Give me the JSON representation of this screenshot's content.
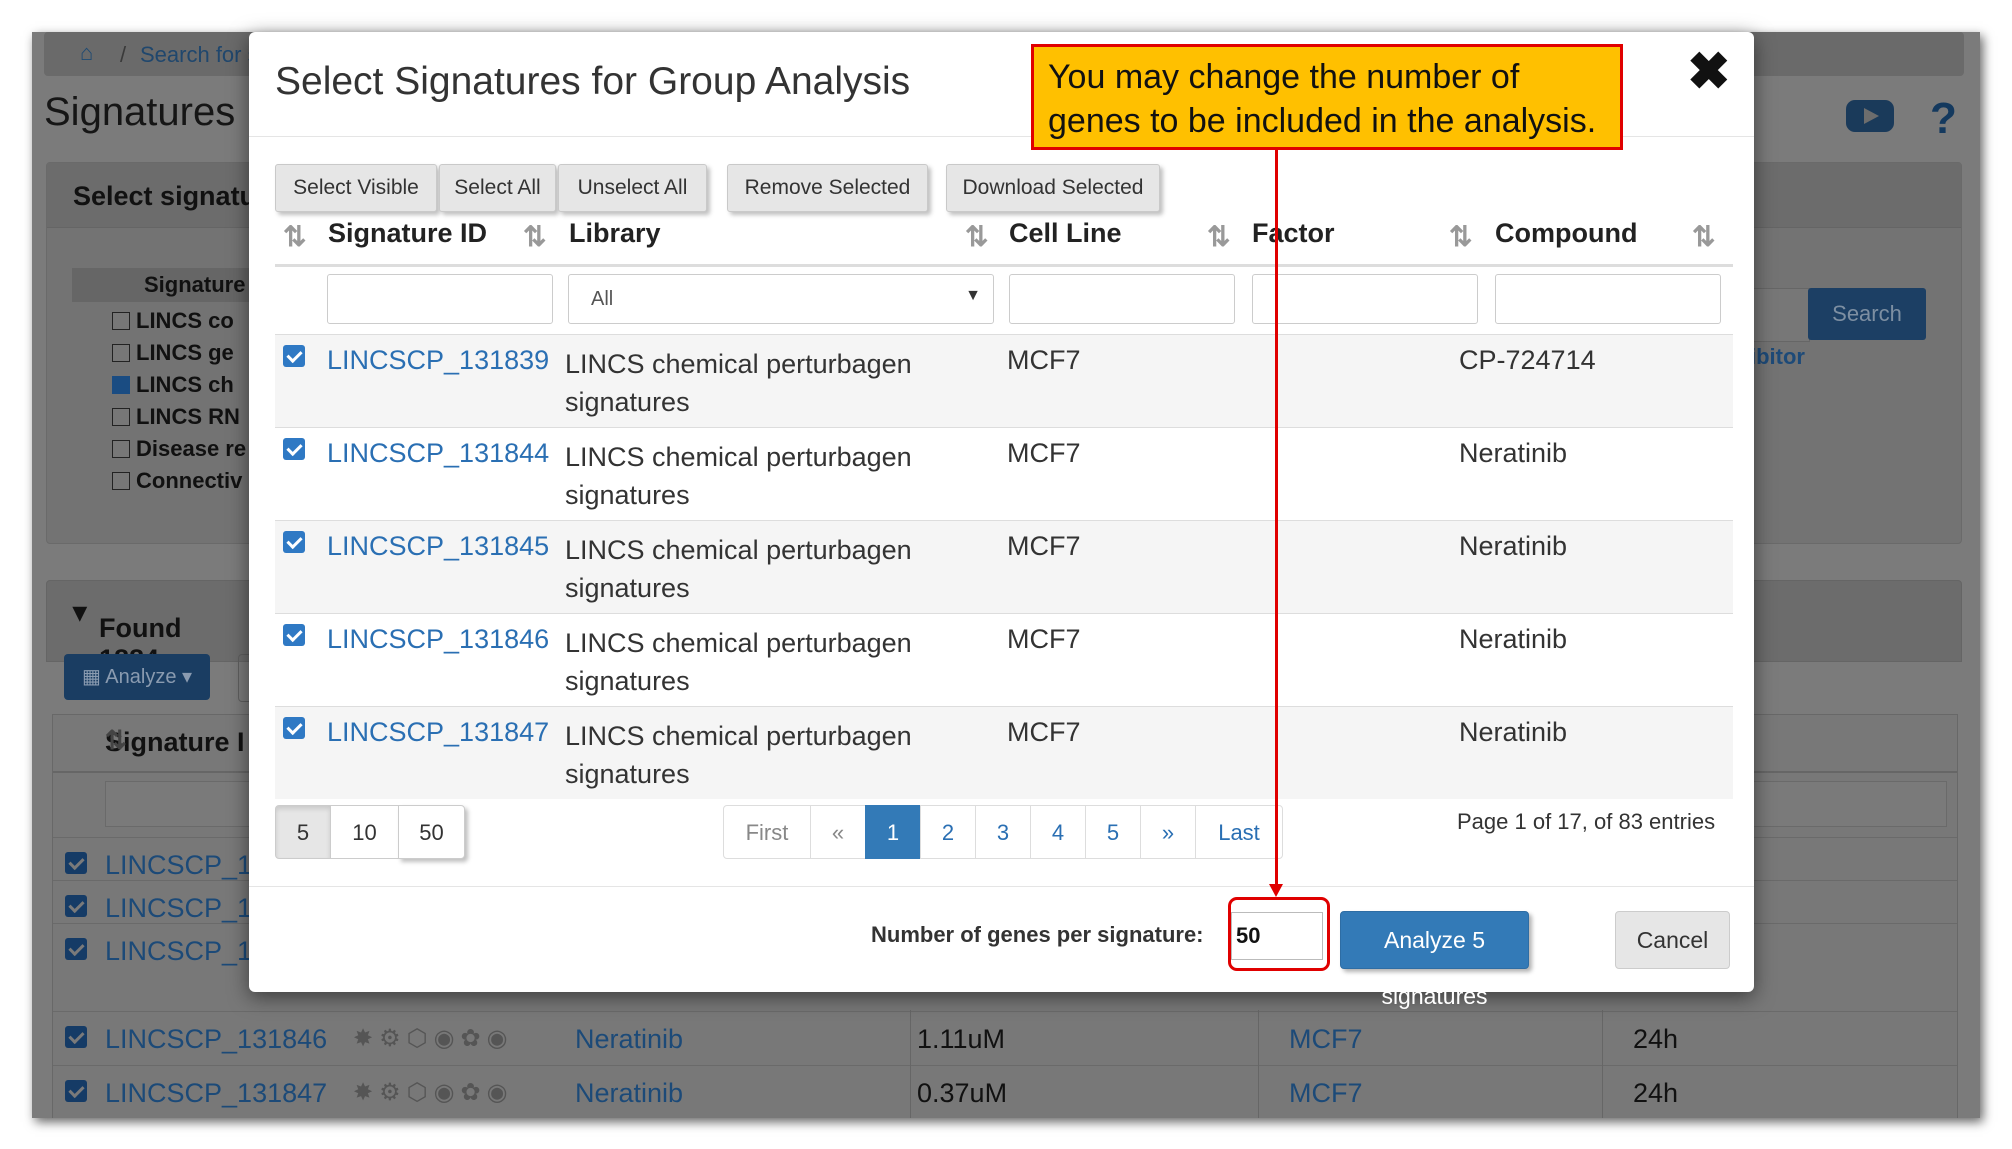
{
  "background": {
    "breadcrumb": "Search for s",
    "title": "Signatures",
    "select_panel_title": "Select signatu",
    "signature_col": "Signature",
    "libraries": [
      {
        "label": "LINCS co",
        "checked": false
      },
      {
        "label": "LINCS ge",
        "checked": false
      },
      {
        "label": "LINCS ch",
        "checked": true
      },
      {
        "label": "LINCS RN",
        "checked": false
      },
      {
        "label": "Disease re",
        "checked": false
      },
      {
        "label": "Connectiv",
        "checked": false
      }
    ],
    "search_button": "Search",
    "partial_link": "ibitor",
    "found_title": "Found 1884",
    "analyze_button": "Analyze",
    "table_header": "Signature I",
    "rows": [
      {
        "id": "LINCSCP_1",
        "compound": "",
        "conc": "",
        "cell": "",
        "time": ""
      },
      {
        "id": "LINCSCP_1",
        "compound": "",
        "conc": "",
        "cell": "",
        "time": ""
      },
      {
        "id": "LINCSCP_1",
        "compound": "",
        "conc": "",
        "cell": "",
        "time": ""
      },
      {
        "id": "LINCSCP_131846",
        "compound": "Neratinib",
        "conc": "1.11uM",
        "cell": "MCF7",
        "time": "24h"
      },
      {
        "id": "LINCSCP_131847",
        "compound": "Neratinib",
        "conc": "0.37uM",
        "cell": "MCF7",
        "time": "24h"
      }
    ]
  },
  "modal": {
    "title": "Select Signatures for Group Analysis",
    "close_icon": "close-icon",
    "toolbar": {
      "select_visible": "Select Visible",
      "select_all": "Select All",
      "unselect_all": "Unselect All",
      "remove_selected": "Remove Selected",
      "download_selected": "Download Selected"
    },
    "columns": {
      "signature_id": "Signature ID",
      "library": "Library",
      "cell_line": "Cell Line",
      "factor": "Factor",
      "compound": "Compound"
    },
    "library_filter_value": "All",
    "rows": [
      {
        "id": "LINCSCP_131839",
        "library": "LINCS chemical perturbagen signatures",
        "cell_line": "MCF7",
        "factor": "",
        "compound": "CP-724714",
        "checked": true
      },
      {
        "id": "LINCSCP_131844",
        "library": "LINCS chemical perturbagen signatures",
        "cell_line": "MCF7",
        "factor": "",
        "compound": "Neratinib",
        "checked": true
      },
      {
        "id": "LINCSCP_131845",
        "library": "LINCS chemical perturbagen signatures",
        "cell_line": "MCF7",
        "factor": "",
        "compound": "Neratinib",
        "checked": true
      },
      {
        "id": "LINCSCP_131846",
        "library": "LINCS chemical perturbagen signatures",
        "cell_line": "MCF7",
        "factor": "",
        "compound": "Neratinib",
        "checked": true
      },
      {
        "id": "LINCSCP_131847",
        "library": "LINCS chemical perturbagen signatures",
        "cell_line": "MCF7",
        "factor": "",
        "compound": "Neratinib",
        "checked": true
      }
    ],
    "page_sizes": [
      "5",
      "10",
      "50"
    ],
    "page_size_selected": "5",
    "pagination": {
      "first": "First",
      "prev": "«",
      "pages": [
        "1",
        "2",
        "3",
        "4",
        "5"
      ],
      "active_page": "1",
      "next": "»",
      "last": "Last"
    },
    "page_info": "Page 1 of 17, of 83 entries",
    "genes_label": "Number of genes per signature:",
    "genes_value": "50",
    "analyze_button": "Analyze 5 signatures",
    "cancel_button": "Cancel"
  },
  "annotation": {
    "callout_text": "You may change the number of genes to be included in the analysis.",
    "color": "#e00000",
    "callout_bg": "#ffc000"
  }
}
